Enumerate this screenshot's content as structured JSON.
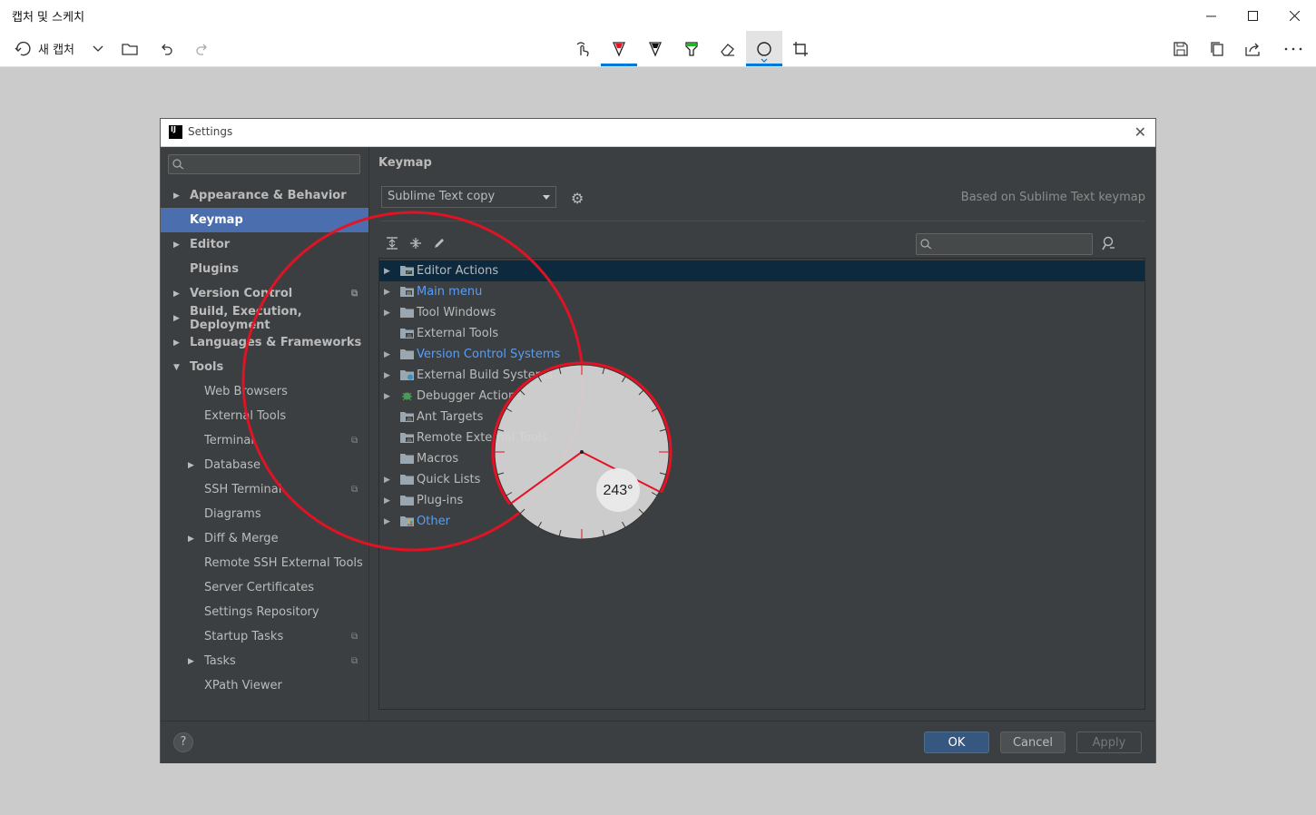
{
  "window": {
    "title": "캡처 및 스케치",
    "controls": {
      "minimize": "minimize-icon",
      "maximize": "maximize-icon",
      "close": "close-icon"
    }
  },
  "toolbar": {
    "new_capture_label": "새 캡처",
    "tools": [
      "touch-writing-icon",
      "ballpoint-pen-icon",
      "pencil-icon",
      "highlighter-icon",
      "eraser-icon",
      "protractor-icon",
      "crop-icon"
    ],
    "colors": {
      "ballpoint": "#e81123",
      "pencil": "#111111",
      "highlighter": "#1fb61f",
      "accent": "#0078d7"
    }
  },
  "dialog": {
    "title": "Settings",
    "logo": "IJ",
    "sidebar": {
      "items": [
        {
          "label": "Appearance & Behavior",
          "level": 0,
          "expandable": true,
          "expanded": false,
          "selected": false,
          "project": false
        },
        {
          "label": "Keymap",
          "level": 0,
          "expandable": false,
          "expanded": false,
          "selected": true,
          "project": false
        },
        {
          "label": "Editor",
          "level": 0,
          "expandable": true,
          "expanded": false,
          "selected": false,
          "project": false
        },
        {
          "label": "Plugins",
          "level": 0,
          "expandable": false,
          "expanded": false,
          "selected": false,
          "project": false
        },
        {
          "label": "Version Control",
          "level": 0,
          "expandable": true,
          "expanded": false,
          "selected": false,
          "project": true
        },
        {
          "label": "Build, Execution, Deployment",
          "level": 0,
          "expandable": true,
          "expanded": false,
          "selected": false,
          "project": false
        },
        {
          "label": "Languages & Frameworks",
          "level": 0,
          "expandable": true,
          "expanded": false,
          "selected": false,
          "project": false
        },
        {
          "label": "Tools",
          "level": 0,
          "expandable": true,
          "expanded": true,
          "selected": false,
          "project": false
        },
        {
          "label": "Web Browsers",
          "level": 1,
          "expandable": false,
          "expanded": false,
          "selected": false,
          "project": false
        },
        {
          "label": "External Tools",
          "level": 1,
          "expandable": false,
          "expanded": false,
          "selected": false,
          "project": false
        },
        {
          "label": "Terminal",
          "level": 1,
          "expandable": false,
          "expanded": false,
          "selected": false,
          "project": true
        },
        {
          "label": "Database",
          "level": 1,
          "expandable": true,
          "expanded": false,
          "selected": false,
          "project": false
        },
        {
          "label": "SSH Terminal",
          "level": 1,
          "expandable": false,
          "expanded": false,
          "selected": false,
          "project": true
        },
        {
          "label": "Diagrams",
          "level": 1,
          "expandable": false,
          "expanded": false,
          "selected": false,
          "project": false
        },
        {
          "label": "Diff & Merge",
          "level": 1,
          "expandable": true,
          "expanded": false,
          "selected": false,
          "project": false
        },
        {
          "label": "Remote SSH External Tools",
          "level": 1,
          "expandable": false,
          "expanded": false,
          "selected": false,
          "project": false
        },
        {
          "label": "Server Certificates",
          "level": 1,
          "expandable": false,
          "expanded": false,
          "selected": false,
          "project": false
        },
        {
          "label": "Settings Repository",
          "level": 1,
          "expandable": false,
          "expanded": false,
          "selected": false,
          "project": false
        },
        {
          "label": "Startup Tasks",
          "level": 1,
          "expandable": false,
          "expanded": false,
          "selected": false,
          "project": true
        },
        {
          "label": "Tasks",
          "level": 1,
          "expandable": true,
          "expanded": false,
          "selected": false,
          "project": true
        },
        {
          "label": "XPath Viewer",
          "level": 1,
          "expandable": false,
          "expanded": false,
          "selected": false,
          "project": false
        }
      ]
    },
    "keymap": {
      "page_title": "Keymap",
      "selected_keymap": "Sublime Text copy",
      "based_on": "Based on Sublime Text keymap",
      "tree": [
        {
          "label": "Editor Actions",
          "expandable": true,
          "selected": true,
          "blue": false,
          "icon": "folder-editor-icon"
        },
        {
          "label": "Main menu",
          "expandable": true,
          "selected": false,
          "blue": true,
          "icon": "folder-menu-icon"
        },
        {
          "label": "Tool Windows",
          "expandable": true,
          "selected": false,
          "blue": false,
          "icon": "folder-icon"
        },
        {
          "label": "External Tools",
          "expandable": false,
          "selected": false,
          "blue": false,
          "icon": "folder-tools-icon"
        },
        {
          "label": "Version Control Systems",
          "expandable": true,
          "selected": false,
          "blue": true,
          "icon": "folder-icon"
        },
        {
          "label": "External Build Systems",
          "expandable": true,
          "selected": false,
          "blue": false,
          "icon": "folder-build-icon"
        },
        {
          "label": "Debugger Actions",
          "expandable": true,
          "selected": false,
          "blue": false,
          "icon": "bug-icon"
        },
        {
          "label": "Ant Targets",
          "expandable": false,
          "selected": false,
          "blue": false,
          "icon": "folder-tools-icon"
        },
        {
          "label": "Remote External Tools",
          "expandable": false,
          "selected": false,
          "blue": false,
          "icon": "folder-tools-icon"
        },
        {
          "label": "Macros",
          "expandable": false,
          "selected": false,
          "blue": false,
          "icon": "folder-icon"
        },
        {
          "label": "Quick Lists",
          "expandable": true,
          "selected": false,
          "blue": false,
          "icon": "folder-icon"
        },
        {
          "label": "Plug-ins",
          "expandable": true,
          "selected": false,
          "blue": false,
          "icon": "folder-icon"
        },
        {
          "label": "Other",
          "expandable": true,
          "selected": false,
          "blue": true,
          "icon": "folder-other-icon"
        }
      ]
    },
    "buttons": {
      "help": "?",
      "ok": "OK",
      "cancel": "Cancel",
      "apply": "Apply"
    }
  },
  "protractor": {
    "angle_label": "243°",
    "angle": 243
  }
}
